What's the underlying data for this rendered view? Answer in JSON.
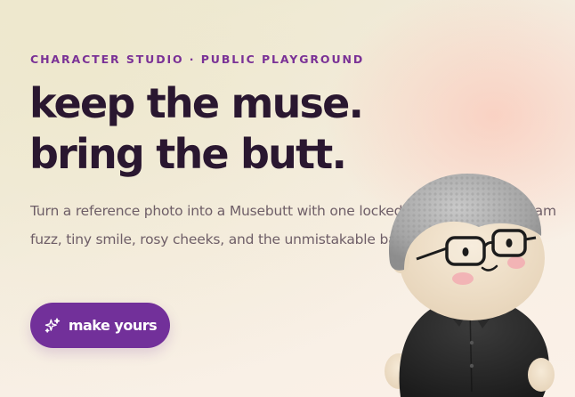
{
  "hero": {
    "kicker": "CHARACTER STUDIO · PUBLIC PLAYGROUND",
    "headline_line1": "keep the muse.",
    "headline_line2": "bring the butt.",
    "description": "Turn a reference photo into a Musebutt with one locked character DNA: cream fuzz, tiny smile, rosy cheeks, and the unmistakable backwards pose.",
    "cta_label": "make yours",
    "cta_icon": "sparkles-icon"
  },
  "colors": {
    "accent": "#72309a",
    "kicker": "#7a3196",
    "headline": "#2a1730",
    "body_text": "#6e5e67"
  }
}
